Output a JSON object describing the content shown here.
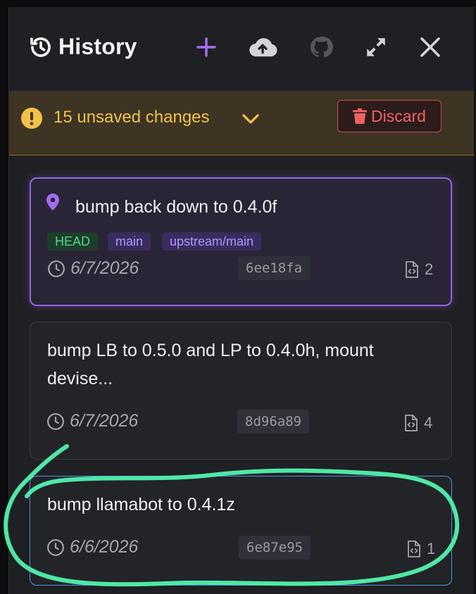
{
  "header": {
    "title": "History",
    "buttons": {
      "new": "new-commit",
      "push": "cloud-upload",
      "github": "github",
      "expand": "expand",
      "close": "close"
    }
  },
  "banner": {
    "text": "15 unsaved changes",
    "discard_label": "Discard"
  },
  "commits": [
    {
      "message": "bump back down to 0.4.0f",
      "tags": [
        "HEAD",
        "main",
        "upstream/main"
      ],
      "date": "6/7/2026",
      "hash": "6ee18fa",
      "files": "2"
    },
    {
      "message": "bump LB to 0.5.0 and LP to 0.4.0h, mount devise...",
      "date": "6/7/2026",
      "hash": "8d96a89",
      "files": "4"
    },
    {
      "message": "bump llamabot to 0.4.1z",
      "date": "6/6/2026",
      "hash": "6e87e95",
      "files": "1"
    }
  ],
  "colors": {
    "accent": "#8f66e8",
    "warning": "#f2c14a",
    "danger": "#e05252",
    "annotation": "#4ee8a6"
  }
}
